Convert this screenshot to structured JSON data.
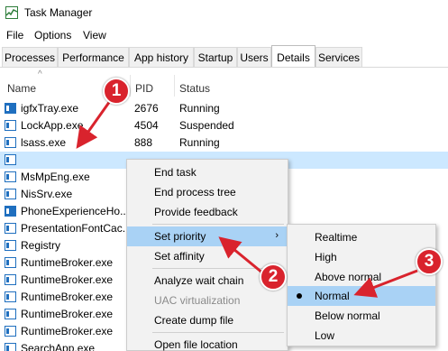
{
  "window": {
    "title": "Task Manager"
  },
  "menu": [
    "File",
    "Options",
    "View"
  ],
  "tabs": [
    "Processes",
    "Performance",
    "App history",
    "Startup",
    "Users",
    "Details",
    "Services"
  ],
  "active_tab": "Details",
  "columns": {
    "name": "Name",
    "pid": "PID",
    "status": "Status"
  },
  "rows": [
    {
      "name": "igfxTray.exe",
      "pid": "2676",
      "status": "Running"
    },
    {
      "name": "LockApp.exe",
      "pid": "4504",
      "status": "Suspended"
    },
    {
      "name": "lsass.exe",
      "pid": "888",
      "status": "Running"
    },
    {
      "name": "",
      "pid": "",
      "status": "",
      "selected": true
    },
    {
      "name": "MsMpEng.exe",
      "pid": "",
      "status": ""
    },
    {
      "name": "NisSrv.exe",
      "pid": "",
      "status": ""
    },
    {
      "name": "PhoneExperienceHo...",
      "pid": "",
      "status": ""
    },
    {
      "name": "PresentationFontCac...",
      "pid": "",
      "status": ""
    },
    {
      "name": "Registry",
      "pid": "",
      "status": ""
    },
    {
      "name": "RuntimeBroker.exe",
      "pid": "",
      "status": ""
    },
    {
      "name": "RuntimeBroker.exe",
      "pid": "",
      "status": ""
    },
    {
      "name": "RuntimeBroker.exe",
      "pid": "",
      "status": ""
    },
    {
      "name": "RuntimeBroker.exe",
      "pid": "",
      "status": ""
    },
    {
      "name": "RuntimeBroker.exe",
      "pid": "",
      "status": ""
    },
    {
      "name": "SearchApp.exe",
      "pid": "",
      "status": ""
    }
  ],
  "context_menu": {
    "end_task": "End task",
    "end_process_tree": "End process tree",
    "provide_feedback": "Provide feedback",
    "set_priority": "Set priority",
    "set_affinity": "Set affinity",
    "analyze_wait_chain": "Analyze wait chain",
    "uac_virtualization": "UAC virtualization",
    "create_dump_file": "Create dump file",
    "open_file_location": "Open file location"
  },
  "priority_menu": {
    "realtime": "Realtime",
    "high": "High",
    "above_normal": "Above normal",
    "normal": "Normal",
    "below_normal": "Below normal",
    "low": "Low"
  },
  "callouts": [
    "1",
    "2",
    "3"
  ],
  "colors": {
    "callout": "#d9232d",
    "selection": "#cce8ff",
    "menu_highlight": "#a9d2f5",
    "icon_blue": "#1f6fbf"
  }
}
